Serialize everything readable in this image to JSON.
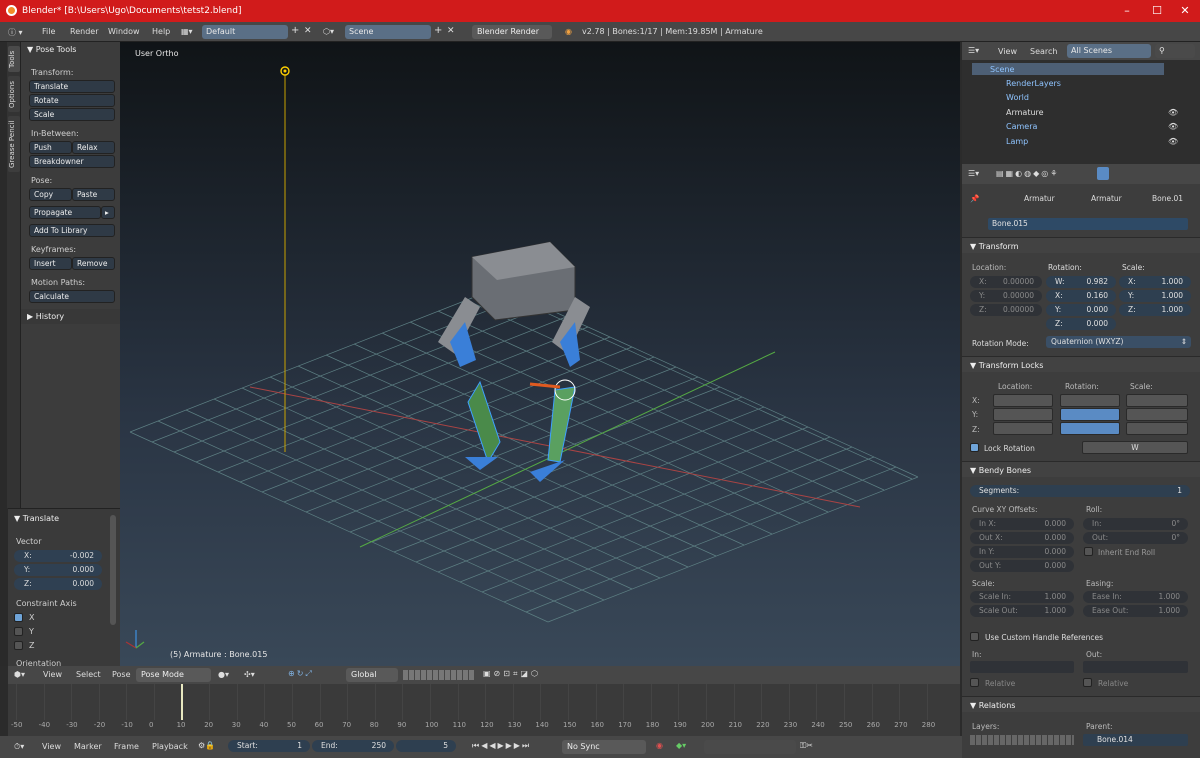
{
  "window": {
    "title": "Blender* [B:\\Users\\Ugo\\Documents\\tetst2.blend]",
    "controls": [
      "–",
      "☐",
      "✕"
    ]
  },
  "topbar": {
    "menus": [
      "File",
      "Render",
      "Window",
      "Help"
    ],
    "layout": "Default",
    "scene": "Scene",
    "engine": "Blender Render",
    "status": "v2.78 | Bones:1/17 | Mem:19.85M | Armature"
  },
  "left_tabs": [
    "Tools",
    "Options",
    "Grease Pencil"
  ],
  "tool_shelf": {
    "panel": "Pose Tools",
    "transform_label": "Transform:",
    "transform": [
      "Translate",
      "Rotate",
      "Scale"
    ],
    "inbetween_label": "In-Between:",
    "push": "Push",
    "relax": "Relax",
    "breakdowner": "Breakdowner",
    "pose_label": "Pose:",
    "copy": "Copy",
    "paste": "Paste",
    "propagate": "Propagate",
    "add_library": "Add To Library",
    "keyframes_label": "Keyframes:",
    "insert": "Insert",
    "remove": "Remove",
    "motion_label": "Motion Paths:",
    "calculate": "Calculate",
    "history": "History"
  },
  "operator": {
    "title": "Translate",
    "vector_label": "Vector",
    "x_label": "X:",
    "x": "-0.002",
    "y_label": "Y:",
    "y": "0.000",
    "z_label": "Z:",
    "z": "0.000",
    "constraint_label": "Constraint Axis",
    "axes": [
      "X",
      "Y",
      "Z"
    ],
    "orientation_label": "Orientation"
  },
  "viewport": {
    "view_name": "User Ortho",
    "object_info": "(5) Armature : Bone.015"
  },
  "outliner": {
    "view": "View",
    "search": "Search",
    "filter": "All Scenes",
    "items": [
      "Scene",
      "RenderLayers",
      "World",
      "Armature",
      "Camera",
      "Lamp"
    ]
  },
  "props": {
    "breadcrumb": [
      "Armatur",
      "Armatur",
      "Bone.01"
    ],
    "bone_name": "Bone.015",
    "transform": {
      "title": "Transform",
      "loc_label": "Location:",
      "rot_label": "Rotation:",
      "scale_label": "Scale:",
      "loc": [
        {
          "k": "X:",
          "v": "0.00000"
        },
        {
          "k": "Y:",
          "v": "0.00000"
        },
        {
          "k": "Z:",
          "v": "0.00000"
        }
      ],
      "rot": [
        {
          "k": "W:",
          "v": "0.982"
        },
        {
          "k": "X:",
          "v": "0.160"
        },
        {
          "k": "Y:",
          "v": "0.000"
        },
        {
          "k": "Z:",
          "v": "0.000"
        }
      ],
      "scale": [
        {
          "k": "X:",
          "v": "1.000"
        },
        {
          "k": "Y:",
          "v": "1.000"
        },
        {
          "k": "Z:",
          "v": "1.000"
        }
      ],
      "mode_label": "Rotation Mode:",
      "mode": "Quaternion (WXYZ)"
    },
    "locks": {
      "title": "Transform Locks",
      "loc_label": "Location:",
      "rot_label": "Rotation:",
      "scale_label": "Scale:",
      "rows": [
        "X:",
        "Y:",
        "Z:"
      ],
      "lock_rotation": "Lock Rotation",
      "w": "W"
    },
    "bendy": {
      "title": "Bendy Bones",
      "segments_label": "Segments:",
      "segments": "1",
      "curve_label": "Curve XY Offsets:",
      "roll_label": "Roll:",
      "inx": {
        "k": "In X:",
        "v": "0.000"
      },
      "outx": {
        "k": "Out X:",
        "v": "0.000"
      },
      "iny": {
        "k": "In Y:",
        "v": "0.000"
      },
      "outy": {
        "k": "Out Y:",
        "v": "0.000"
      },
      "rin": {
        "k": "In:",
        "v": "0°"
      },
      "rout": {
        "k": "Out:",
        "v": "0°"
      },
      "inherit": "Inherit End Roll",
      "scale_label": "Scale:",
      "easing_label": "Easing:",
      "scalein": {
        "k": "Scale In:",
        "v": "1.000"
      },
      "scaleout": {
        "k": "Scale Out:",
        "v": "1.000"
      },
      "easein": {
        "k": "Ease In:",
        "v": "1.000"
      },
      "easeout": {
        "k": "Ease Out:",
        "v": "1.000"
      },
      "custom": "Use Custom Handle References",
      "in_label": "In:",
      "out_label": "Out:",
      "relative": "Relative"
    },
    "relations": {
      "title": "Relations",
      "layers_label": "Layers:",
      "parent_label": "Parent:",
      "parent": "Bone.014"
    }
  },
  "viewport_header": {
    "menus": [
      "View",
      "Select",
      "Pose"
    ],
    "mode": "Pose Mode",
    "orientation": "Global"
  },
  "timeline": {
    "ticks": [
      "-50",
      "-40",
      "-30",
      "-20",
      "-10",
      "0",
      "10",
      "20",
      "30",
      "40",
      "50",
      "60",
      "70",
      "80",
      "90",
      "100",
      "110",
      "120",
      "130",
      "140",
      "150",
      "160",
      "170",
      "180",
      "190",
      "200",
      "210",
      "220",
      "230",
      "240",
      "250",
      "260",
      "270",
      "280"
    ],
    "menus": [
      "View",
      "Marker",
      "Frame",
      "Playback"
    ],
    "start_label": "Start:",
    "start": "1",
    "end_label": "End:",
    "end": "250",
    "current": "5",
    "sync": "No Sync"
  }
}
